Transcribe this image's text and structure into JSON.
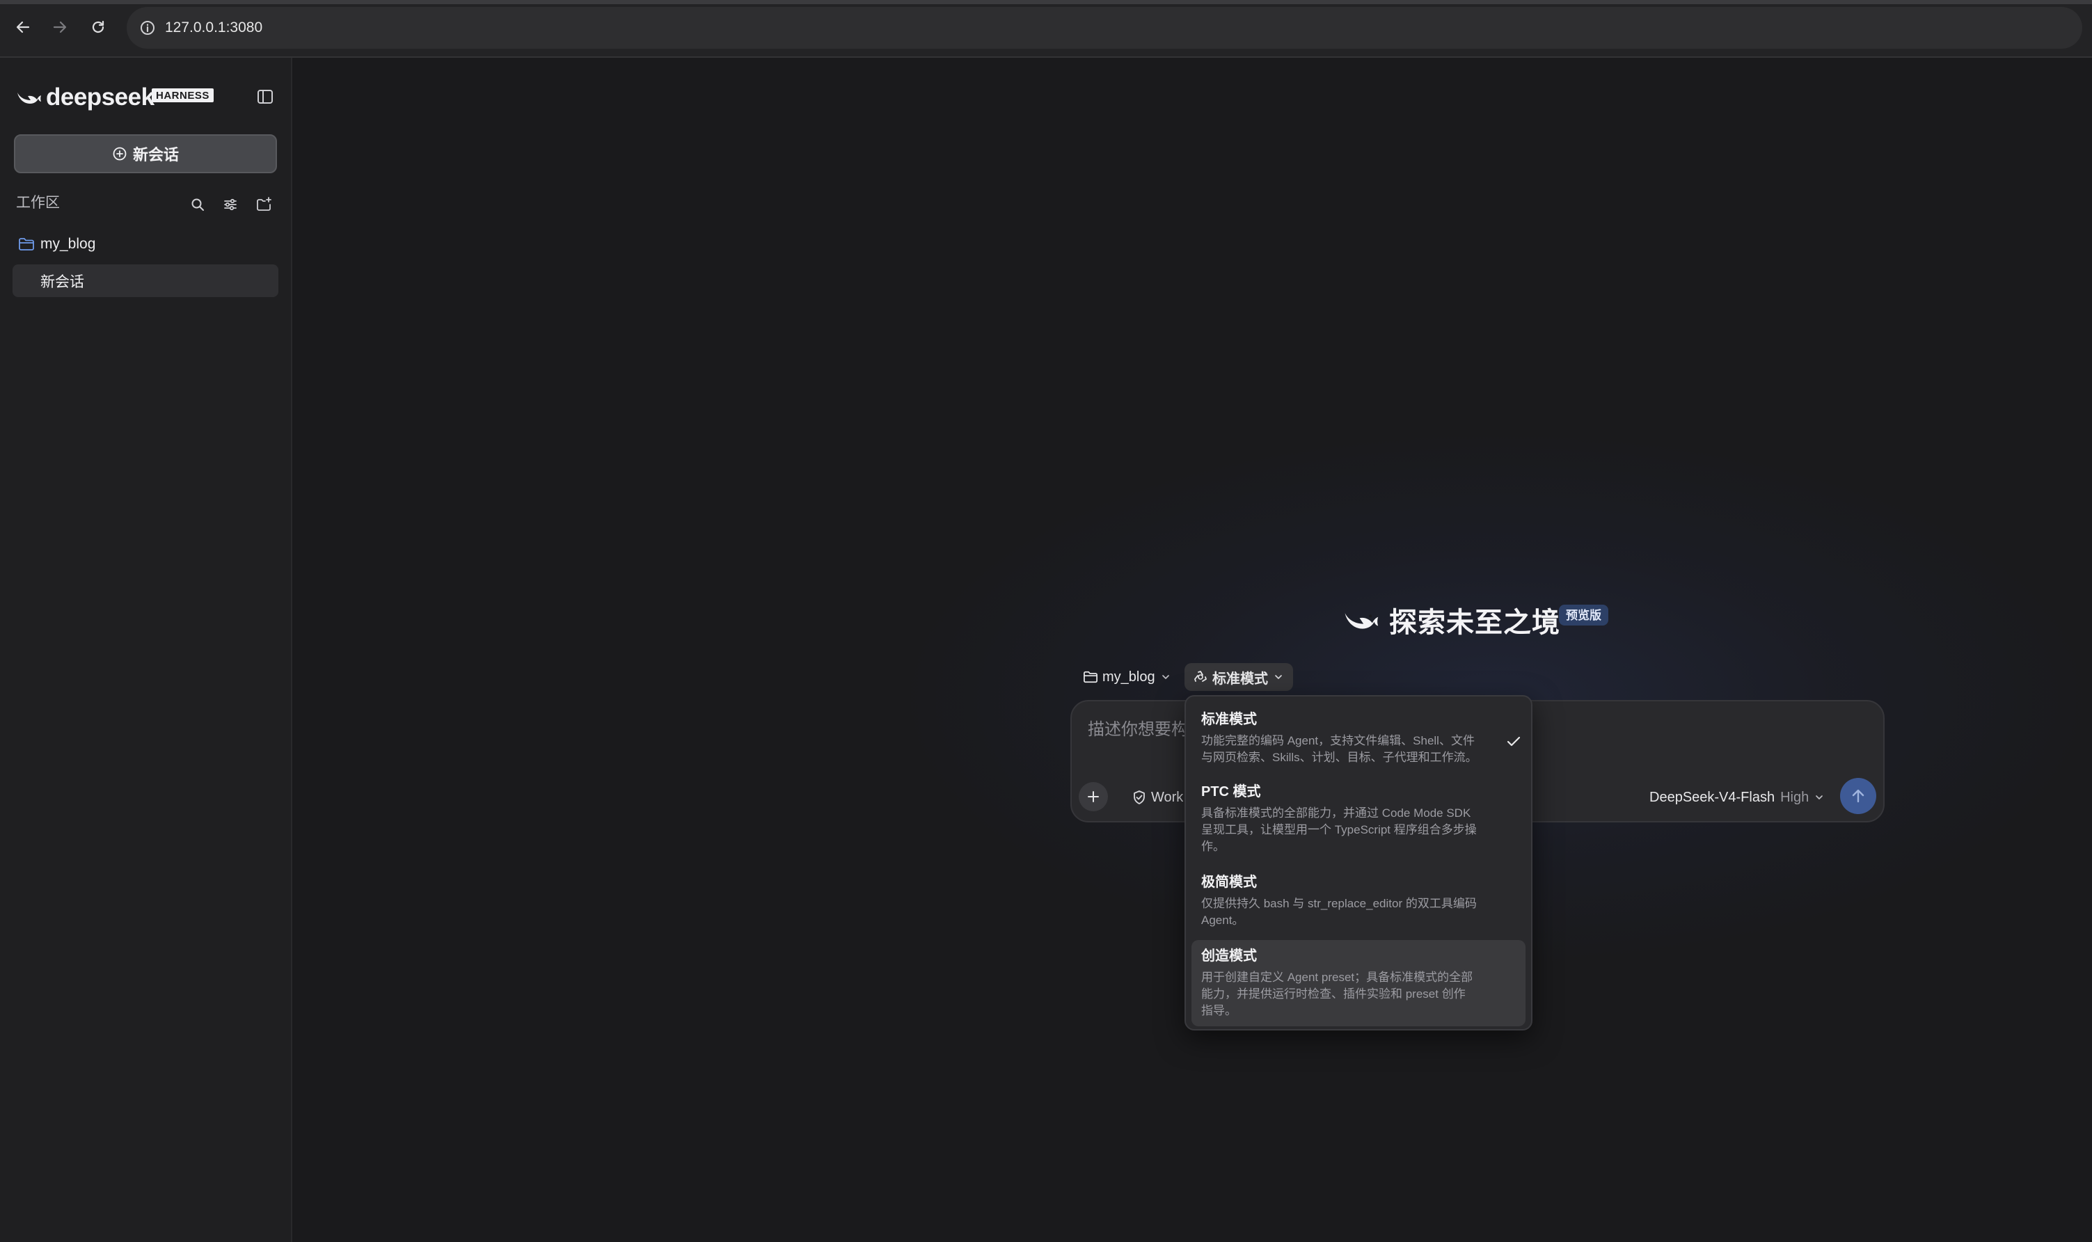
{
  "browser": {
    "url": "127.0.0.1:3080"
  },
  "sidebar": {
    "brand": "deepseek",
    "brand_badge": "HARNESS",
    "new_chat_label": "新会话",
    "workspace_label": "工作区",
    "folder_name": "my_blog",
    "sessions": [
      {
        "label": "新会话"
      }
    ]
  },
  "main": {
    "hero_title": "探索未至之境",
    "hero_badge": "预览版",
    "folder_chip": "my_blog",
    "mode_chip": "标准模式",
    "composer": {
      "placeholder": "描述你想要构",
      "work_chip": "Work",
      "model": "DeepSeek-V4-Flash",
      "effort": "High"
    }
  },
  "mode_menu": {
    "selected": "标准模式",
    "options": [
      {
        "title": "标准模式",
        "desc_lines": [
          "功能完整的编码 Agent，支持文件编辑、Shell、文件",
          "与网页检索、Skills、计划、目标、子代理和工作流。"
        ]
      },
      {
        "title": "PTC 模式",
        "desc_lines": [
          "具备标准模式的全部能力，并通过 Code Mode SDK",
          "呈现工具，让模型用一个 TypeScript 程序组合多步操",
          "作。"
        ]
      },
      {
        "title": "极简模式",
        "desc_lines": [
          "仅提供持久 bash 与 str_replace_editor 的双工具编码",
          "Agent。"
        ]
      },
      {
        "title": "创造模式",
        "desc_lines": [
          "用于创建自定义 Agent preset；具备标准模式的全部",
          "能力，并提供运行时检查、插件实验和 preset 创作",
          "指导。"
        ]
      }
    ]
  },
  "colors": {
    "accent": "#3e5a96",
    "sidebar_bg": "#1f1f21",
    "main_bg": "#1a1a1c",
    "folder_icon": "#6f9bea"
  }
}
